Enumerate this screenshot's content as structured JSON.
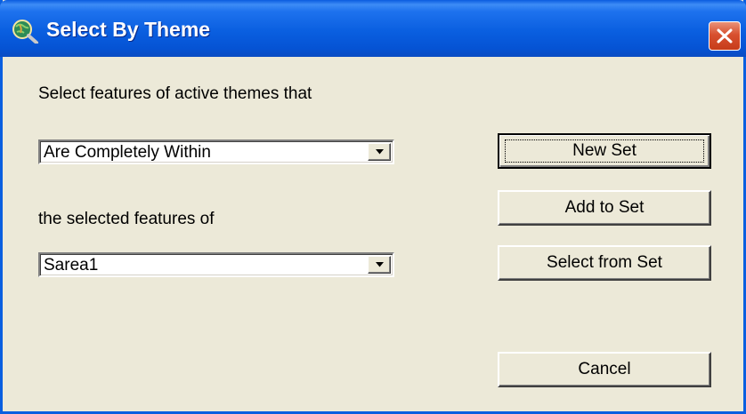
{
  "window": {
    "title": "Select By Theme",
    "icon": "globe-magnifier-icon",
    "close_icon": "close-icon",
    "colors": {
      "titlebar": "#0A5FE0",
      "close": "#D8502F",
      "face": "#ECE9D8"
    }
  },
  "form": {
    "prompt_label": "Select features of active themes that",
    "relation_select": {
      "value": "Are Completely Within"
    },
    "target_label": "the selected features of",
    "theme_select": {
      "value": "Sarea1"
    }
  },
  "buttons": {
    "new_set": "New Set",
    "add_to_set": "Add to Set",
    "select_from_set": "Select from Set",
    "cancel": "Cancel"
  }
}
